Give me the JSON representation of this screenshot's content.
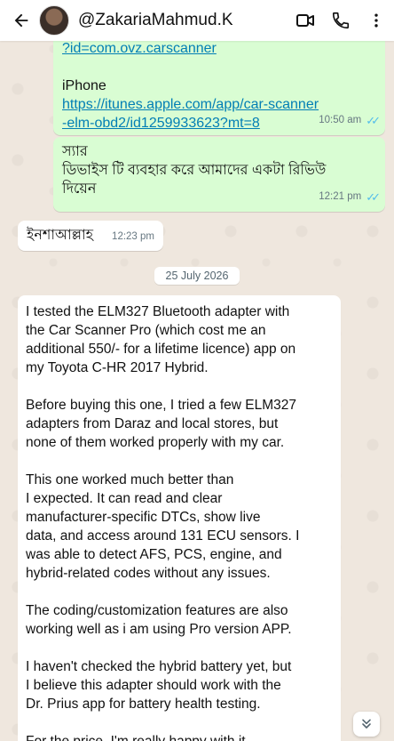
{
  "header": {
    "contact_name": "@ZakariaMahmud.K",
    "icons": [
      "back-arrow-icon",
      "video-call-icon",
      "phone-icon",
      "more-vert-icon"
    ]
  },
  "messages": {
    "m1": {
      "link_tail": "?id=com.ovz.carscanner",
      "label": "iPhone",
      "link1": "https://itunes.apple.com/app/car-scanner",
      "link2": "-elm-obd2/id1259933623?mt=8",
      "time": "10:50 am"
    },
    "m2": {
      "line1": "স্যার",
      "line2": "ডিভাইস টি ব্যবহার করে আমাদের একটা রিভিউ",
      "line3": "দিয়েন",
      "time": "12:21 pm"
    },
    "m3": {
      "text": "ইনশাআল্লাহ",
      "time": "12:23 pm"
    },
    "date_divider": "25 July 2026",
    "m4": {
      "p1": [
        "I tested the ELM327 Bluetooth adapter with",
        "the Car Scanner Pro (which cost me an",
        "additional 550/- for a lifetime licence) app on",
        "my Toyota C-HR 2017 Hybrid."
      ],
      "p2": [
        "Before buying this one, I tried a few ELM327",
        "adapters from Daraz and local stores, but",
        "none of them worked properly with my car."
      ],
      "p3": [
        "This one worked much better than",
        "I expected. It can read and clear",
        "manufacturer-specific DTCs, show live",
        "data, and access around 131 ECU sensors. I",
        "was able to detect AFS, PCS, engine, and",
        "hybrid-related codes without any issues."
      ],
      "p4": [
        "The coding/customization features are also",
        "working well as i am using Pro version APP."
      ],
      "p5": [
        "I haven't checked the hybrid battery yet, but",
        "I believe this adapter should work with the",
        "Dr. Prius app for battery health testing."
      ],
      "p6": [
        "For the price, I'm really happy with it."
      ]
    }
  },
  "colors": {
    "outgoing_bubble": "#d9fdd3",
    "incoming_bubble": "#ffffff",
    "link": "#027eb5",
    "read_ticks": "#53bdeb",
    "chat_background": "#efe7de"
  }
}
